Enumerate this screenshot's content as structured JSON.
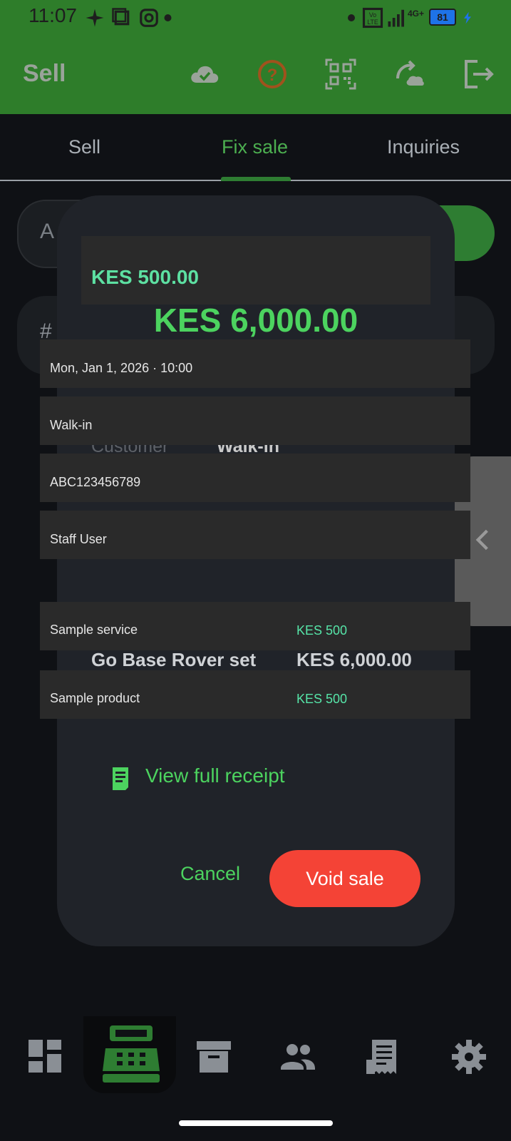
{
  "status_bar": {
    "time": "11:07",
    "network": "4G+",
    "battery": "81"
  },
  "app_bar": {
    "title": "Sell"
  },
  "tabs": [
    {
      "label": "Sell"
    },
    {
      "label": "Fix sale"
    },
    {
      "label": "Inquiries"
    }
  ],
  "background": {
    "search_letter": "A",
    "card_hash": "#"
  },
  "dialog": {
    "price_box": "KES 500.00",
    "total": "KES 6,000.00",
    "rows": [
      {
        "text": "Mon, Jan 1, 2026 · 10:00"
      },
      {
        "text": "Walk-in"
      },
      {
        "text": "ABC123456789"
      },
      {
        "text": "Staff User"
      }
    ],
    "ghost_customer_label": "Customer",
    "ghost_customer_value": "Walk-in",
    "ghost_item": "Go Base Rover set",
    "ghost_item_price": "KES 6,000.00",
    "items": [
      {
        "name": "Sample service",
        "price": "KES 500"
      },
      {
        "name": "Sample product",
        "price": "KES 500"
      }
    ],
    "receipt_link": "View full receipt",
    "cancel": "Cancel",
    "void": "Void sale"
  },
  "colors": {
    "accent": "#4cd35f",
    "danger": "#f44336",
    "brand": "#2e7d2a"
  }
}
